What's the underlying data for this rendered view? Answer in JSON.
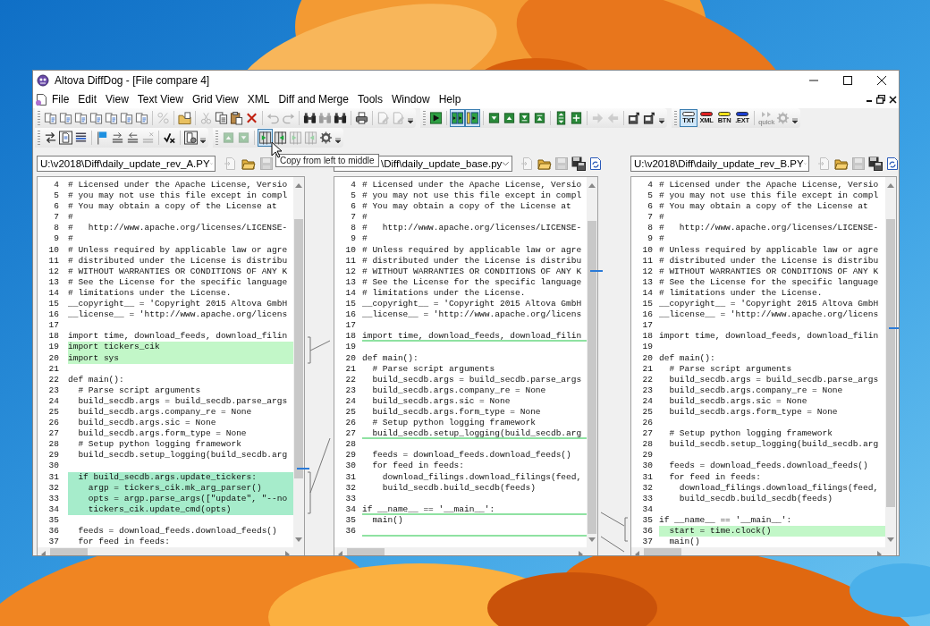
{
  "window": {
    "title": "Altova DiffDog - [File compare 4]"
  },
  "menu": [
    {
      "label": "File"
    },
    {
      "label": "Edit"
    },
    {
      "label": "View"
    },
    {
      "label": "Text View"
    },
    {
      "label": "Grid View"
    },
    {
      "label": "XML"
    },
    {
      "label": "Diff and Merge"
    },
    {
      "label": "Tools"
    },
    {
      "label": "Window"
    },
    {
      "label": "Help"
    }
  ],
  "toolbar_rows": [
    [
      {
        "items": [
          {
            "kind": "compare",
            "disabled": false,
            "highlighted": false
          },
          {
            "kind": "compare",
            "disabled": false,
            "highlighted": false
          },
          {
            "kind": "compare",
            "disabled": false,
            "highlighted": false
          },
          {
            "kind": "compare",
            "disabled": false,
            "highlighted": false
          },
          {
            "kind": "compare",
            "disabled": false,
            "highlighted": false
          },
          {
            "kind": "compare",
            "disabled": false,
            "highlighted": false
          },
          {
            "kind": "compare",
            "disabled": false,
            "highlighted": false
          },
          {
            "kind": "separator"
          },
          {
            "kind": "percent",
            "disabled": true,
            "highlighted": false
          },
          {
            "kind": "separator"
          },
          {
            "kind": "folder_compare",
            "disabled": false,
            "highlighted": false
          },
          {
            "kind": "separator"
          },
          {
            "kind": "cut",
            "disabled": true,
            "highlighted": false
          },
          {
            "kind": "copy",
            "disabled": false,
            "highlighted": false
          },
          {
            "kind": "paste",
            "disabled": false,
            "highlighted": false
          },
          {
            "kind": "delete",
            "disabled": false,
            "highlighted": false
          },
          {
            "kind": "separator"
          },
          {
            "kind": "undo",
            "disabled": true,
            "highlighted": false
          },
          {
            "kind": "redo",
            "disabled": true,
            "highlighted": false
          },
          {
            "kind": "separator"
          },
          {
            "kind": "find",
            "disabled": false,
            "highlighted": false
          },
          {
            "kind": "find",
            "disabled": true,
            "highlighted": false
          },
          {
            "kind": "find",
            "disabled": false,
            "highlighted": false
          },
          {
            "kind": "separator"
          },
          {
            "kind": "print",
            "disabled": false,
            "highlighted": false
          },
          {
            "kind": "separator"
          },
          {
            "kind": "doc_edit",
            "disabled": true,
            "highlighted": false
          },
          {
            "kind": "doc_edit",
            "disabled": true,
            "highlighted": false
          },
          {
            "kind": "overflow"
          }
        ]
      },
      {
        "items": [
          {
            "kind": "play",
            "disabled": false,
            "highlighted": false
          },
          {
            "kind": "separator"
          },
          {
            "kind": "layout_h",
            "disabled": false,
            "highlighted": true
          },
          {
            "kind": "layout_v",
            "disabled": false,
            "highlighted": true
          },
          {
            "kind": "separator"
          },
          {
            "kind": "down",
            "disabled": false,
            "highlighted": false
          },
          {
            "kind": "up",
            "disabled": false,
            "highlighted": false
          },
          {
            "kind": "first",
            "disabled": false,
            "highlighted": false
          },
          {
            "kind": "last",
            "disabled": false,
            "highlighted": false
          },
          {
            "kind": "separator"
          },
          {
            "kind": "expand",
            "disabled": false,
            "highlighted": false
          },
          {
            "kind": "collapse",
            "disabled": false,
            "highlighted": false
          },
          {
            "kind": "separator"
          },
          {
            "kind": "move_right",
            "disabled": true,
            "highlighted": false
          },
          {
            "kind": "move_left",
            "disabled": true,
            "highlighted": false
          },
          {
            "kind": "separator"
          },
          {
            "kind": "export",
            "disabled": false,
            "highlighted": false
          },
          {
            "kind": "export",
            "disabled": false,
            "highlighted": false
          },
          {
            "kind": "overflow"
          }
        ]
      },
      {
        "items": [
          {
            "kind": "tag",
            "label": "TXT",
            "color": "#f4f4f4",
            "disabled": false,
            "highlighted": true
          },
          {
            "kind": "tag",
            "label": "XML",
            "color": "#e02020",
            "disabled": false,
            "highlighted": false
          },
          {
            "kind": "tag",
            "label": "BTN",
            "color": "#f2e21a",
            "disabled": false,
            "highlighted": false
          },
          {
            "kind": "tag",
            "label": ".EXT",
            "color": "#1c3fd0",
            "disabled": false,
            "highlighted": false
          },
          {
            "kind": "separator"
          },
          {
            "kind": "quick",
            "label": "quick",
            "disabled": true,
            "highlighted": false
          },
          {
            "kind": "options",
            "disabled": true,
            "highlighted": false
          },
          {
            "kind": "overflow"
          }
        ]
      }
    ],
    [
      {
        "items": [
          {
            "kind": "swap",
            "disabled": false,
            "highlighted": false
          },
          {
            "kind": "doc_box",
            "disabled": false,
            "highlighted": false
          },
          {
            "kind": "list",
            "disabled": false,
            "highlighted": false
          },
          {
            "kind": "separator"
          },
          {
            "kind": "flag",
            "disabled": false,
            "highlighted": false
          },
          {
            "kind": "list_right",
            "disabled": false,
            "highlighted": false
          },
          {
            "kind": "list_left",
            "disabled": false,
            "highlighted": false
          },
          {
            "kind": "list_delete",
            "disabled": true,
            "highlighted": false
          },
          {
            "kind": "separator"
          },
          {
            "kind": "tick",
            "disabled": false,
            "highlighted": false
          },
          {
            "kind": "separator"
          },
          {
            "kind": "doc_gear",
            "disabled": false,
            "highlighted": false
          },
          {
            "kind": "overflow"
          }
        ]
      },
      {
        "items": [
          {
            "kind": "up",
            "disabled": true,
            "highlighted": false
          },
          {
            "kind": "down",
            "disabled": true,
            "highlighted": false
          },
          {
            "kind": "separator"
          },
          {
            "kind": "copy_lr",
            "disabled": false,
            "highlighted": true
          },
          {
            "kind": "copy_rl",
            "disabled": false,
            "highlighted": false
          },
          {
            "kind": "copy_lr",
            "disabled": true,
            "highlighted": false
          },
          {
            "kind": "copy_rl",
            "disabled": true,
            "highlighted": false
          },
          {
            "kind": "options",
            "disabled": false,
            "highlighted": false
          },
          {
            "kind": "overflow"
          }
        ]
      }
    ]
  ],
  "tooltip": "Copy from left to middle",
  "panes": [
    {
      "path": "U:\\v2018\\Diff\\daily_update_rev_A.PY",
      "file_buttons": [
        {
          "kind": "open",
          "disabled": true
        },
        {
          "kind": "folder",
          "disabled": false
        },
        {
          "kind": "save",
          "disabled": true
        }
      ],
      "lines": [
        {
          "n": "4",
          "text": "# Licensed under the Apache License, Versio",
          "changed": false,
          "current": false
        },
        {
          "n": "5",
          "text": "# you may not use this file except in compl",
          "changed": false,
          "current": false
        },
        {
          "n": "6",
          "text": "# You may obtain a copy of the License at",
          "changed": false,
          "current": false
        },
        {
          "n": "7",
          "text": "#",
          "changed": false,
          "current": false
        },
        {
          "n": "8",
          "text": "#   http://www.apache.org/licenses/LICENSE-",
          "changed": false,
          "current": false
        },
        {
          "n": "9",
          "text": "#",
          "changed": false,
          "current": false
        },
        {
          "n": "10",
          "text": "# Unless required by applicable law or agre",
          "changed": false,
          "current": false
        },
        {
          "n": "11",
          "text": "# distributed under the License is distribu",
          "changed": false,
          "current": false
        },
        {
          "n": "12",
          "text": "# WITHOUT WARRANTIES OR CONDITIONS OF ANY K",
          "changed": false,
          "current": false
        },
        {
          "n": "13",
          "text": "# See the License for the specific language",
          "changed": false,
          "current": false
        },
        {
          "n": "14",
          "text": "# limitations under the License.",
          "changed": false,
          "current": false
        },
        {
          "n": "15",
          "text": "__copyright__ = 'Copyright 2015 Altova GmbH",
          "changed": false,
          "current": false
        },
        {
          "n": "16",
          "text": "__license__ = 'http://www.apache.org/licens",
          "changed": false,
          "current": false
        },
        {
          "n": "17",
          "changed": false,
          "current": false
        },
        {
          "n": "18",
          "text": "import time, download_feeds, download_filin",
          "changed": false,
          "current": false
        },
        {
          "n": "19",
          "text": "import tickers_cik",
          "changed": true,
          "current": false
        },
        {
          "n": "20",
          "text": "import sys",
          "changed": true,
          "current": false
        },
        {
          "n": "21",
          "changed": false,
          "current": false
        },
        {
          "n": "22",
          "text": "def main():",
          "changed": false,
          "current": false
        },
        {
          "n": "23",
          "text": "  # Parse script arguments",
          "changed": false,
          "current": false
        },
        {
          "n": "24",
          "text": "  build_secdb.args = build_secdb.parse_args",
          "changed": false,
          "current": false
        },
        {
          "n": "25",
          "text": "  build_secdb.args.company_re = None",
          "changed": false,
          "current": false
        },
        {
          "n": "26",
          "text": "  build_secdb.args.sic = None",
          "changed": false,
          "current": false
        },
        {
          "n": "27",
          "text": "  build_secdb.args.form_type = None",
          "changed": false,
          "current": false
        },
        {
          "n": "28",
          "text": "  # Setup python logging framework",
          "changed": false,
          "current": false
        },
        {
          "n": "29",
          "text": "  build_secdb.setup_logging(build_secdb.arg",
          "changed": false,
          "current": false
        },
        {
          "n": "30",
          "changed": false,
          "current": false
        },
        {
          "n": "31",
          "text": "  if build_secdb.args.update_tickers:",
          "changed": true,
          "current": true
        },
        {
          "n": "32",
          "text": "    argp = tickers_cik.mk_arg_parser()",
          "changed": true,
          "current": true
        },
        {
          "n": "33",
          "text": "    opts = argp.parse_args([\"update\", \"--no",
          "changed": true,
          "current": true
        },
        {
          "n": "34",
          "text": "    tickers_cik.update_cmd(opts)",
          "changed": true,
          "current": true
        },
        {
          "n": "35",
          "changed": false,
          "current": false
        },
        {
          "n": "36",
          "text": "  feeds = download_feeds.download_feeds()",
          "changed": false,
          "current": false
        },
        {
          "n": "37",
          "text": "  for feed in feeds:",
          "changed": false,
          "current": false
        }
      ]
    },
    {
      "path": "\\Diff\\daily_update_base.py",
      "file_buttons": [
        {
          "kind": "open",
          "disabled": true
        },
        {
          "kind": "folder",
          "disabled": false
        },
        {
          "kind": "save",
          "disabled": true
        },
        {
          "kind": "save_as",
          "disabled": false
        },
        {
          "kind": "reload",
          "disabled": false
        }
      ],
      "lines": [
        {
          "n": "4",
          "text": "# Licensed under the Apache License, Versio",
          "changed": false,
          "current": false,
          "gap_below": false
        },
        {
          "n": "5",
          "text": "# you may not use this file except in compl",
          "changed": false,
          "current": false,
          "gap_below": false
        },
        {
          "n": "6",
          "text": "# You may obtain a copy of the License at",
          "changed": false,
          "current": false,
          "gap_below": false
        },
        {
          "n": "7",
          "text": "#",
          "changed": false,
          "current": false,
          "gap_below": false
        },
        {
          "n": "8",
          "text": "#   http://www.apache.org/licenses/LICENSE-",
          "changed": false,
          "current": false,
          "gap_below": false
        },
        {
          "n": "9",
          "text": "#",
          "changed": false,
          "current": false,
          "gap_below": false
        },
        {
          "n": "10",
          "text": "# Unless required by applicable law or agre",
          "changed": false,
          "current": false,
          "gap_below": false
        },
        {
          "n": "11",
          "text": "# distributed under the License is distribu",
          "changed": false,
          "current": false,
          "gap_below": false
        },
        {
          "n": "12",
          "text": "# WITHOUT WARRANTIES OR CONDITIONS OF ANY K",
          "changed": false,
          "current": false,
          "gap_below": false
        },
        {
          "n": "13",
          "text": "# See the License for the specific language",
          "changed": false,
          "current": false,
          "gap_below": false
        },
        {
          "n": "14",
          "text": "# limitations under the License.",
          "changed": false,
          "current": false,
          "gap_below": false
        },
        {
          "n": "15",
          "text": "__copyright__ = 'Copyright 2015 Altova GmbH",
          "changed": false,
          "current": false,
          "gap_below": false
        },
        {
          "n": "16",
          "text": "__license__ = 'http://www.apache.org/licens",
          "changed": false,
          "current": false,
          "gap_below": false
        },
        {
          "n": "17",
          "changed": false,
          "current": false,
          "gap_below": false
        },
        {
          "n": "18",
          "text": "import time, download_feeds, download_filin",
          "changed": false,
          "current": false,
          "gap_below": true
        },
        {
          "n": "19",
          "changed": false,
          "current": false,
          "gap_below": false
        },
        {
          "n": "20",
          "text": "def main():",
          "changed": false,
          "current": false,
          "gap_below": false
        },
        {
          "n": "21",
          "text": "  # Parse script arguments",
          "changed": false,
          "current": false,
          "gap_below": false
        },
        {
          "n": "22",
          "text": "  build_secdb.args = build_secdb.parse_args",
          "changed": false,
          "current": false,
          "gap_below": false
        },
        {
          "n": "23",
          "text": "  build_secdb.args.company_re = None",
          "changed": false,
          "current": false,
          "gap_below": false
        },
        {
          "n": "24",
          "text": "  build_secdb.args.sic = None",
          "changed": false,
          "current": false,
          "gap_below": false
        },
        {
          "n": "25",
          "text": "  build_secdb.args.form_type = None",
          "changed": false,
          "current": false,
          "gap_below": false
        },
        {
          "n": "26",
          "text": "  # Setup python logging framework",
          "changed": false,
          "current": false,
          "gap_below": false
        },
        {
          "n": "27",
          "text": "  build_secdb.setup_logging(build_secdb.arg",
          "changed": false,
          "current": false,
          "gap_below": true
        },
        {
          "n": "28",
          "changed": false,
          "current": false,
          "gap_below": false
        },
        {
          "n": "29",
          "text": "  feeds = download_feeds.download_feeds()",
          "changed": false,
          "current": false,
          "gap_below": false
        },
        {
          "n": "30",
          "text": "  for feed in feeds:",
          "changed": false,
          "current": false,
          "gap_below": false
        },
        {
          "n": "31",
          "text": "    download_filings.download_filings(feed,",
          "changed": false,
          "current": false,
          "gap_below": false
        },
        {
          "n": "32",
          "text": "    build_secdb.build_secdb(feeds)",
          "changed": false,
          "current": false,
          "gap_below": false
        },
        {
          "n": "33",
          "changed": false,
          "current": false,
          "gap_below": false
        },
        {
          "n": "34",
          "text": "if __name__ == '__main__':",
          "changed": false,
          "current": false,
          "gap_below": true
        },
        {
          "n": "35",
          "text": "  main()",
          "changed": false,
          "current": false,
          "gap_below": false
        },
        {
          "n": "36",
          "changed": false,
          "current": false,
          "gap_below": true
        }
      ]
    },
    {
      "path": "U:\\v2018\\Diff\\daily_update_rev_B.PY",
      "file_buttons": [
        {
          "kind": "open",
          "disabled": true
        },
        {
          "kind": "folder",
          "disabled": false
        },
        {
          "kind": "save",
          "disabled": true
        },
        {
          "kind": "save_as",
          "disabled": false
        },
        {
          "kind": "reload",
          "disabled": false
        }
      ],
      "lines": [
        {
          "n": "4",
          "text": "# Licensed under the Apache License, Versio",
          "changed": false,
          "current": false
        },
        {
          "n": "5",
          "text": "# you may not use this file except in compl",
          "changed": false,
          "current": false
        },
        {
          "n": "6",
          "text": "# You may obtain a copy of the License at",
          "changed": false,
          "current": false
        },
        {
          "n": "7",
          "text": "#",
          "changed": false,
          "current": false
        },
        {
          "n": "8",
          "text": "#   http://www.apache.org/licenses/LICENSE-",
          "changed": false,
          "current": false
        },
        {
          "n": "9",
          "text": "#",
          "changed": false,
          "current": false
        },
        {
          "n": "10",
          "text": "# Unless required by applicable law or agre",
          "changed": false,
          "current": false
        },
        {
          "n": "11",
          "text": "# distributed under the License is distribu",
          "changed": false,
          "current": false
        },
        {
          "n": "12",
          "text": "# WITHOUT WARRANTIES OR CONDITIONS OF ANY K",
          "changed": false,
          "current": false
        },
        {
          "n": "13",
          "text": "# See the License for the specific language",
          "changed": false,
          "current": false
        },
        {
          "n": "14",
          "text": "# limitations under the License.",
          "changed": false,
          "current": false
        },
        {
          "n": "15",
          "text": "__copyright__ = 'Copyright 2015 Altova GmbH",
          "changed": false,
          "current": false
        },
        {
          "n": "16",
          "text": "__license__ = 'http://www.apache.org/licens",
          "changed": false,
          "current": false
        },
        {
          "n": "17",
          "changed": false,
          "current": false
        },
        {
          "n": "18",
          "text": "import time, download_feeds, download_filin",
          "changed": false,
          "current": false
        },
        {
          "n": "19",
          "changed": false,
          "current": false
        },
        {
          "n": "20",
          "text": "def main():",
          "changed": false,
          "current": false
        },
        {
          "n": "21",
          "text": "  # Parse script arguments",
          "changed": false,
          "current": false
        },
        {
          "n": "22",
          "text": "  build_secdb.args = build_secdb.parse_args",
          "changed": false,
          "current": false
        },
        {
          "n": "23",
          "text": "  build_secdb.args.company_re = None",
          "changed": false,
          "current": false
        },
        {
          "n": "24",
          "text": "  build_secdb.args.sic = None",
          "changed": false,
          "current": false
        },
        {
          "n": "25",
          "text": "  build_secdb.args.form_type = None",
          "changed": false,
          "current": false
        },
        {
          "n": "26",
          "changed": false,
          "current": false
        },
        {
          "n": "27",
          "text": "  # Setup python logging framework",
          "changed": false,
          "current": false
        },
        {
          "n": "28",
          "text": "  build_secdb.setup_logging(build_secdb.arg",
          "changed": false,
          "current": false
        },
        {
          "n": "29",
          "changed": false,
          "current": false
        },
        {
          "n": "30",
          "text": "  feeds = download_feeds.download_feeds()",
          "changed": false,
          "current": false
        },
        {
          "n": "31",
          "text": "  for feed in feeds:",
          "changed": false,
          "current": false
        },
        {
          "n": "32",
          "text": "    download_filings.download_filings(feed,",
          "changed": false,
          "current": false
        },
        {
          "n": "33",
          "text": "    build_secdb.build_secdb(feeds)",
          "changed": false,
          "current": false
        },
        {
          "n": "34",
          "changed": false,
          "current": false
        },
        {
          "n": "35",
          "text": "if __name__ == '__main__':",
          "changed": false,
          "current": false
        },
        {
          "n": "36",
          "text": "  start = time.clock()",
          "changed": true,
          "current": false
        },
        {
          "n": "37",
          "text": "  main()",
          "changed": false,
          "current": false
        }
      ]
    }
  ]
}
